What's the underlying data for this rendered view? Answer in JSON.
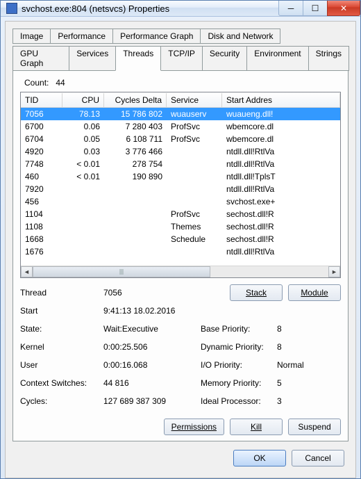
{
  "title": "svchost.exe:804 (netsvcs) Properties",
  "tabs_row1": [
    "Image",
    "Performance",
    "Performance Graph",
    "Disk and Network"
  ],
  "tabs_row2": [
    "GPU Graph",
    "Services",
    "Threads",
    "TCP/IP",
    "Security",
    "Environment",
    "Strings"
  ],
  "active_tab": "Threads",
  "count_label": "Count:",
  "count_value": "44",
  "columns": {
    "tid": "TID",
    "cpu": "CPU",
    "cycles": "Cycles Delta",
    "service": "Service",
    "addr": "Start Addres"
  },
  "rows": [
    {
      "tid": "7056",
      "cpu": "78.13",
      "cycles": "15 786 802",
      "service": "wuauserv",
      "addr": "wuaueng.dll!",
      "selected": true
    },
    {
      "tid": "6700",
      "cpu": "0.06",
      "cycles": "7 280 403",
      "service": "ProfSvc",
      "addr": "wbemcore.dl"
    },
    {
      "tid": "6704",
      "cpu": "0.05",
      "cycles": "6 108 711",
      "service": "ProfSvc",
      "addr": "wbemcore.dl"
    },
    {
      "tid": "4920",
      "cpu": "0.03",
      "cycles": "3 776 466",
      "service": "",
      "addr": "ntdll.dll!RtlVa"
    },
    {
      "tid": "7748",
      "cpu": "< 0.01",
      "cycles": "278 754",
      "service": "",
      "addr": "ntdll.dll!RtlVa"
    },
    {
      "tid": "460",
      "cpu": "< 0.01",
      "cycles": "190 890",
      "service": "",
      "addr": "ntdll.dll!TplsT"
    },
    {
      "tid": "7920",
      "cpu": "",
      "cycles": "",
      "service": "",
      "addr": "ntdll.dll!RtlVa"
    },
    {
      "tid": "456",
      "cpu": "",
      "cycles": "",
      "service": "",
      "addr": "svchost.exe+"
    },
    {
      "tid": "1104",
      "cpu": "",
      "cycles": "",
      "service": "ProfSvc",
      "addr": "sechost.dll!R"
    },
    {
      "tid": "1108",
      "cpu": "",
      "cycles": "",
      "service": "Themes",
      "addr": "sechost.dll!R"
    },
    {
      "tid": "1668",
      "cpu": "",
      "cycles": "",
      "service": "Schedule",
      "addr": "sechost.dll!R"
    },
    {
      "tid": "1676",
      "cpu": "",
      "cycles": "",
      "service": "",
      "addr": "ntdll.dll!RtlVa"
    }
  ],
  "detail": {
    "thread_label": "Thread",
    "thread_val": "7056",
    "start_label": "Start",
    "start_val": "9:41:13   18.02.2016",
    "state_label": "State:",
    "state_val": "Wait:Executive",
    "kernel_label": "Kernel",
    "kernel_val": "0:00:25.506",
    "user_label": "User",
    "user_val": "0:00:16.068",
    "ctx_label": "Context Switches:",
    "ctx_val": "44 816",
    "cycles_label": "Cycles:",
    "cycles_val": "127 689 387 309",
    "baseprio_label": "Base Priority:",
    "baseprio_val": "8",
    "dynprio_label": "Dynamic Priority:",
    "dynprio_val": "8",
    "ioprio_label": "I/O Priority:",
    "ioprio_val": "Normal",
    "memprio_label": "Memory Priority:",
    "memprio_val": "5",
    "ideal_label": "Ideal Processor:",
    "ideal_val": "3"
  },
  "buttons": {
    "stack": "Stack",
    "module": "Module",
    "permissions": "Permissions",
    "kill": "Kill",
    "suspend": "Suspend",
    "ok": "OK",
    "cancel": "Cancel"
  }
}
